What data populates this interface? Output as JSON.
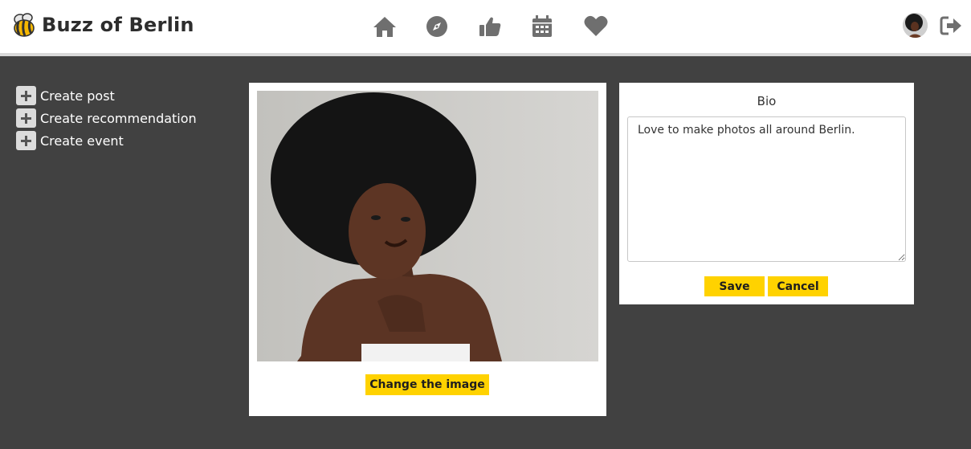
{
  "app": {
    "title": "Buzz of Berlin",
    "logo_icon": "bee-icon"
  },
  "nav": {
    "items": [
      {
        "name": "home",
        "icon": "home-icon"
      },
      {
        "name": "explore",
        "icon": "compass-icon"
      },
      {
        "name": "recommendations",
        "icon": "thumbs-up-icon"
      },
      {
        "name": "events",
        "icon": "calendar-icon"
      },
      {
        "name": "favorites",
        "icon": "heart-icon"
      }
    ],
    "icon_color": "#6f6f6f"
  },
  "user": {
    "avatar_icon": "avatar",
    "logout_icon": "logout-icon"
  },
  "sidebar": {
    "items": [
      {
        "label": "Create post",
        "icon": "plus-icon"
      },
      {
        "label": "Create recommendation",
        "icon": "plus-icon"
      },
      {
        "label": "Create event",
        "icon": "plus-icon"
      }
    ]
  },
  "profile_image": {
    "change_button_label": "Change the image"
  },
  "bio": {
    "title": "Bio",
    "text": "Love to make photos all around Berlin.",
    "save_label": "Save",
    "cancel_label": "Cancel"
  },
  "colors": {
    "accent": "#ffd200",
    "background": "#414141",
    "header": "#ffffff"
  }
}
